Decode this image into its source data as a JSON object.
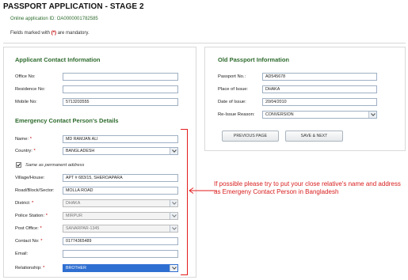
{
  "page": {
    "title": "PASSPORT APPLICATION - STAGE 2",
    "application_id": "Online application ID: OA0000001782585",
    "mandatory_prefix": "Fields marked with ",
    "mandatory_marker": "(*)",
    "mandatory_suffix": " are mandatory."
  },
  "contact": {
    "title": "Applicant Contact Information",
    "office_label": "Office No:",
    "office_value": "",
    "residence_label": "Residence No:",
    "residence_value": "",
    "mobile_label": "Mobile No:",
    "mobile_value": "5713203555"
  },
  "emergency": {
    "title": "Emergency Contact Person's Details",
    "name_label": "Name:",
    "name_value": "MD RAMJAN ALI",
    "country_label": "Country:",
    "country_value": "BANGLADESH",
    "same_address_label": "Same as permanent address",
    "same_address_checked": true,
    "village_label": "Village/House:",
    "village_value": "APT # 683/15, SHEROAPARA",
    "road_label": "Road/Block/Sector:",
    "road_value": "MOLLA ROAD",
    "district_label": "District:",
    "district_value": "DHAKA",
    "police_label": "Police Station:",
    "police_value": "MIRPUR",
    "post_label": "Post Office:",
    "post_value": "SANARPAR-1345",
    "contact_label": "Contact No:",
    "contact_value": "01774365489",
    "email_label": "Email:",
    "email_value": "",
    "relationship_label": "Relationship:",
    "relationship_value": "BROTHER",
    "required_marker": "*"
  },
  "old_passport": {
    "title": "Old Passport Information",
    "passport_label": "Passport No.:",
    "passport_value": "AD545678",
    "place_label": "Place of Issue:",
    "place_value": "DHAKA",
    "date_label": "Date of Issue:",
    "date_value": "20/04/2010",
    "reason_label": "Re-Issue Reason:",
    "reason_value": "CONVERSION"
  },
  "buttons": {
    "previous": "PREVIOUS PAGE",
    "save_next": "SAVE & NEXT"
  },
  "annotation": {
    "note": "If possible please try to put your close relative's name and address as Emergeny Contact Person in Bangladesh",
    "color": "#d81d1d"
  }
}
